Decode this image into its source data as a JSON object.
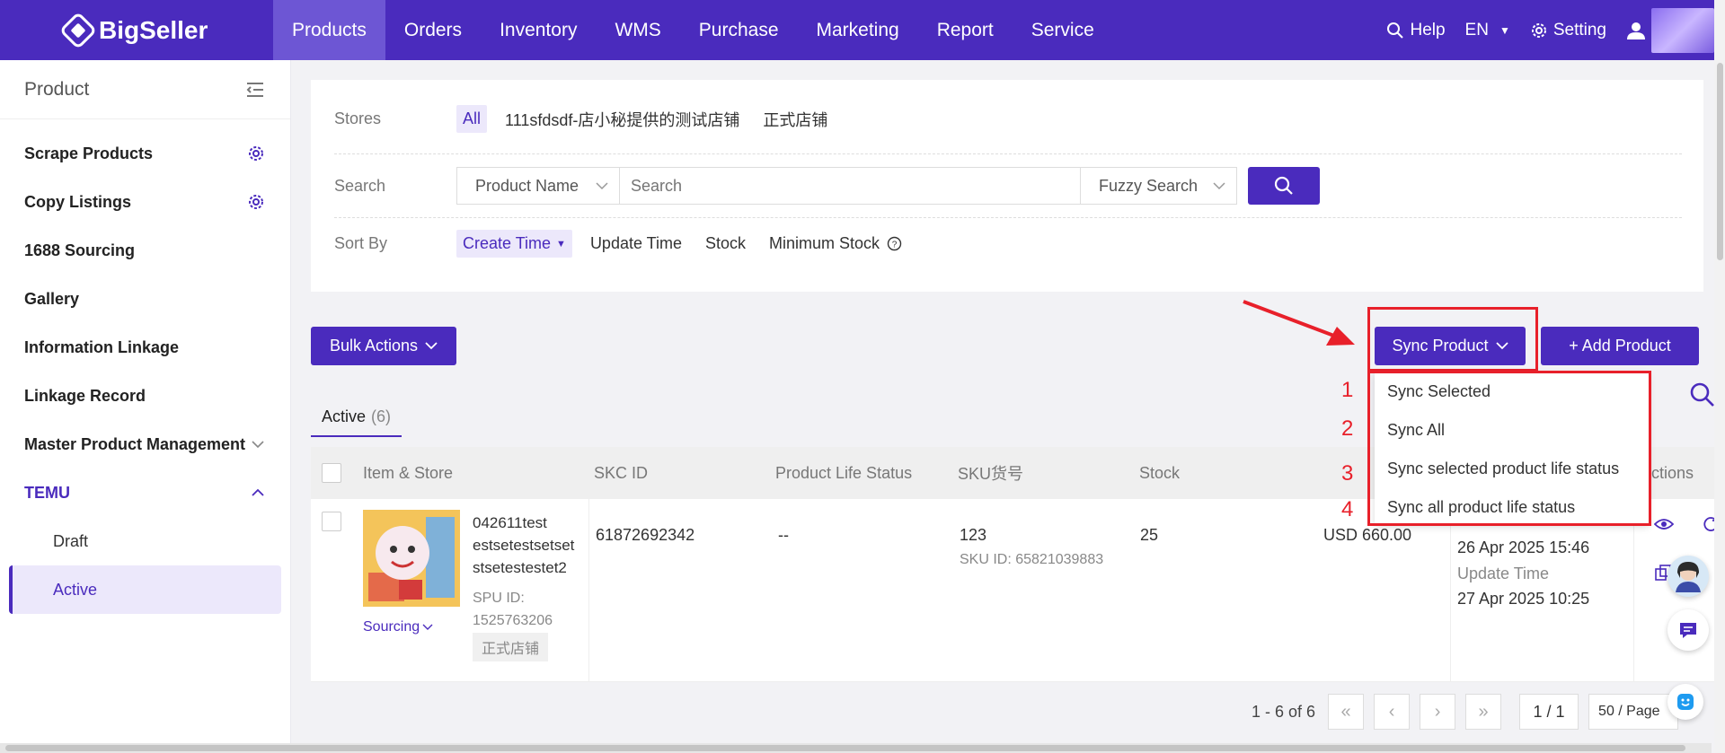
{
  "brand": "BigSeller",
  "nav": {
    "items": [
      "Products",
      "Orders",
      "Inventory",
      "WMS",
      "Purchase",
      "Marketing",
      "Report",
      "Service"
    ],
    "active": "Products",
    "help": "Help",
    "lang": "EN",
    "setting": "Setting"
  },
  "sidebar": {
    "title": "Product",
    "items": [
      {
        "label": "Scrape Products"
      },
      {
        "label": "Copy Listings"
      },
      {
        "label": "1688 Sourcing"
      },
      {
        "label": "Gallery"
      },
      {
        "label": "Information Linkage"
      },
      {
        "label": "Linkage Record"
      },
      {
        "label": "Master Product Management"
      },
      {
        "label": "TEMU"
      }
    ],
    "sub_items": [
      "Draft",
      "Active"
    ],
    "active_sub": "Active"
  },
  "filters": {
    "stores_label": "Stores",
    "stores": [
      "All",
      "111sfdsdf-店小秘提供的测试店铺",
      "正式店铺"
    ],
    "search_label": "Search",
    "search_field": "Product Name",
    "search_placeholder": "Search",
    "search_mode": "Fuzzy Search",
    "sort_label": "Sort By",
    "sort_options": [
      "Create Time",
      "Update Time",
      "Stock",
      "Minimum Stock"
    ]
  },
  "actions": {
    "bulk": "Bulk Actions",
    "sync": "Sync Product",
    "add": "+ Add Product"
  },
  "sync_menu": {
    "items": [
      "Sync Selected",
      "Sync All",
      "Sync selected product life status",
      "Sync all product life status"
    ],
    "numbers": [
      "1",
      "2",
      "3",
      "4"
    ]
  },
  "tabs": {
    "active_label": "Active",
    "active_count": "(6)"
  },
  "table": {
    "columns": [
      "Item & Store",
      "SKC ID",
      "Product Life Status",
      "SKU货号",
      "Stock",
      "Actions"
    ],
    "row": {
      "title_lines": [
        "042611test",
        "estsetestsetset",
        "stsetestestet2"
      ],
      "spu_label": "SPU ID:",
      "spu_id": "1525763206",
      "store_tag": "正式店铺",
      "sourcing": "Sourcing",
      "skc_id": "61872692342",
      "life_status": "--",
      "sku_code": "123",
      "sku_id": "SKU ID: 65821039883",
      "stock": "25",
      "price": "USD 660.00",
      "create_time": "26 Apr 2025 15:46",
      "update_label": "Update Time",
      "update_time": "27 Apr 2025 10:25"
    }
  },
  "pagination": {
    "range": "1 - 6 of 6",
    "page": "1 / 1",
    "per_page": "50 / Page"
  },
  "colors": {
    "brand": "#4a2bbd",
    "annotation": "#e8202a"
  }
}
